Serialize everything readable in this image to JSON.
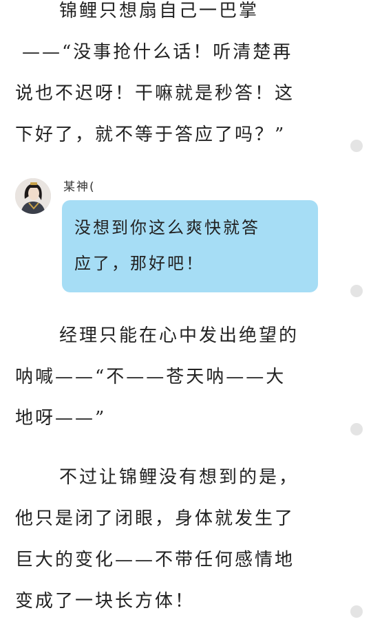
{
  "paragraph1": {
    "lines": [
      "锦鲤只想扇自己一巴掌",
      "——“没事抢什么话！听清楚再",
      "说也不迟呀！干嘛就是秒答！这",
      "下好了，就不等于答应了吗？”"
    ]
  },
  "chat": {
    "speaker": "某神(",
    "message_lines": [
      "没想到你这么爽快就答",
      "应了，那好吧！"
    ],
    "bubble_color": "#a6ddf5"
  },
  "paragraph2": {
    "lines": [
      "经理只能在心中发出绝望的",
      "呐喊——“不——苍天呐——大",
      "地呀——”"
    ]
  },
  "paragraph3": {
    "lines": [
      "不过让锦鲤没有想到的是，",
      "他只是闭了闭眼，身体就发生了",
      "巨大的变化——不带任何感情地",
      "变成了一块长方体！"
    ]
  }
}
